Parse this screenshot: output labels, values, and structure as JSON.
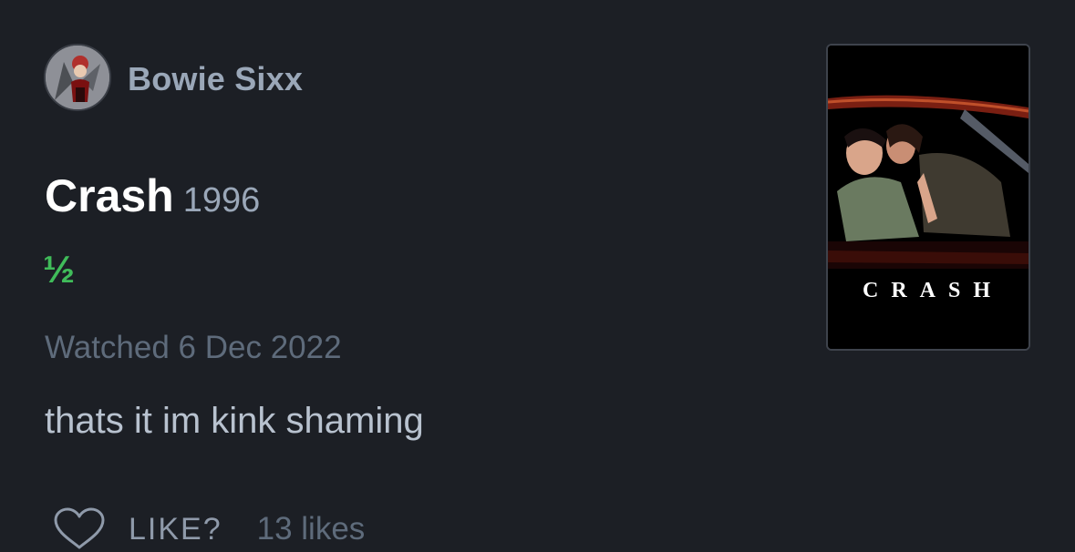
{
  "user": {
    "name": "Bowie Sixx"
  },
  "film": {
    "title": "Crash",
    "year": "1996",
    "rating": "½",
    "poster_title": "CRASH"
  },
  "entry": {
    "watched": "Watched 6 Dec 2022",
    "review": "thats it im kink shaming"
  },
  "actions": {
    "like_label": "LIKE?",
    "likes_count": "13 likes"
  },
  "colors": {
    "background": "#1c1f25",
    "rating_green": "#40bc5a",
    "muted_text": "#5e6b7b",
    "username": "#9aa7b8"
  },
  "icons": {
    "like": "heart-outline-icon"
  }
}
